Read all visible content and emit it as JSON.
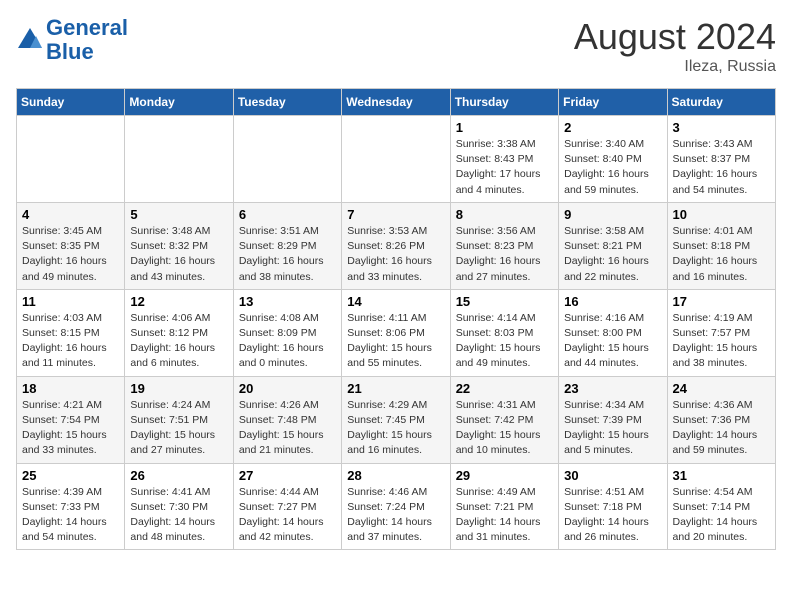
{
  "header": {
    "logo_line1": "General",
    "logo_line2": "Blue",
    "month_year": "August 2024",
    "location": "Ileza, Russia"
  },
  "days_of_week": [
    "Sunday",
    "Monday",
    "Tuesday",
    "Wednesday",
    "Thursday",
    "Friday",
    "Saturday"
  ],
  "weeks": [
    [
      {
        "day": "",
        "info": ""
      },
      {
        "day": "",
        "info": ""
      },
      {
        "day": "",
        "info": ""
      },
      {
        "day": "",
        "info": ""
      },
      {
        "day": "1",
        "info": "Sunrise: 3:38 AM\nSunset: 8:43 PM\nDaylight: 17 hours\nand 4 minutes."
      },
      {
        "day": "2",
        "info": "Sunrise: 3:40 AM\nSunset: 8:40 PM\nDaylight: 16 hours\nand 59 minutes."
      },
      {
        "day": "3",
        "info": "Sunrise: 3:43 AM\nSunset: 8:37 PM\nDaylight: 16 hours\nand 54 minutes."
      }
    ],
    [
      {
        "day": "4",
        "info": "Sunrise: 3:45 AM\nSunset: 8:35 PM\nDaylight: 16 hours\nand 49 minutes."
      },
      {
        "day": "5",
        "info": "Sunrise: 3:48 AM\nSunset: 8:32 PM\nDaylight: 16 hours\nand 43 minutes."
      },
      {
        "day": "6",
        "info": "Sunrise: 3:51 AM\nSunset: 8:29 PM\nDaylight: 16 hours\nand 38 minutes."
      },
      {
        "day": "7",
        "info": "Sunrise: 3:53 AM\nSunset: 8:26 PM\nDaylight: 16 hours\nand 33 minutes."
      },
      {
        "day": "8",
        "info": "Sunrise: 3:56 AM\nSunset: 8:23 PM\nDaylight: 16 hours\nand 27 minutes."
      },
      {
        "day": "9",
        "info": "Sunrise: 3:58 AM\nSunset: 8:21 PM\nDaylight: 16 hours\nand 22 minutes."
      },
      {
        "day": "10",
        "info": "Sunrise: 4:01 AM\nSunset: 8:18 PM\nDaylight: 16 hours\nand 16 minutes."
      }
    ],
    [
      {
        "day": "11",
        "info": "Sunrise: 4:03 AM\nSunset: 8:15 PM\nDaylight: 16 hours\nand 11 minutes."
      },
      {
        "day": "12",
        "info": "Sunrise: 4:06 AM\nSunset: 8:12 PM\nDaylight: 16 hours\nand 6 minutes."
      },
      {
        "day": "13",
        "info": "Sunrise: 4:08 AM\nSunset: 8:09 PM\nDaylight: 16 hours\nand 0 minutes."
      },
      {
        "day": "14",
        "info": "Sunrise: 4:11 AM\nSunset: 8:06 PM\nDaylight: 15 hours\nand 55 minutes."
      },
      {
        "day": "15",
        "info": "Sunrise: 4:14 AM\nSunset: 8:03 PM\nDaylight: 15 hours\nand 49 minutes."
      },
      {
        "day": "16",
        "info": "Sunrise: 4:16 AM\nSunset: 8:00 PM\nDaylight: 15 hours\nand 44 minutes."
      },
      {
        "day": "17",
        "info": "Sunrise: 4:19 AM\nSunset: 7:57 PM\nDaylight: 15 hours\nand 38 minutes."
      }
    ],
    [
      {
        "day": "18",
        "info": "Sunrise: 4:21 AM\nSunset: 7:54 PM\nDaylight: 15 hours\nand 33 minutes."
      },
      {
        "day": "19",
        "info": "Sunrise: 4:24 AM\nSunset: 7:51 PM\nDaylight: 15 hours\nand 27 minutes."
      },
      {
        "day": "20",
        "info": "Sunrise: 4:26 AM\nSunset: 7:48 PM\nDaylight: 15 hours\nand 21 minutes."
      },
      {
        "day": "21",
        "info": "Sunrise: 4:29 AM\nSunset: 7:45 PM\nDaylight: 15 hours\nand 16 minutes."
      },
      {
        "day": "22",
        "info": "Sunrise: 4:31 AM\nSunset: 7:42 PM\nDaylight: 15 hours\nand 10 minutes."
      },
      {
        "day": "23",
        "info": "Sunrise: 4:34 AM\nSunset: 7:39 PM\nDaylight: 15 hours\nand 5 minutes."
      },
      {
        "day": "24",
        "info": "Sunrise: 4:36 AM\nSunset: 7:36 PM\nDaylight: 14 hours\nand 59 minutes."
      }
    ],
    [
      {
        "day": "25",
        "info": "Sunrise: 4:39 AM\nSunset: 7:33 PM\nDaylight: 14 hours\nand 54 minutes."
      },
      {
        "day": "26",
        "info": "Sunrise: 4:41 AM\nSunset: 7:30 PM\nDaylight: 14 hours\nand 48 minutes."
      },
      {
        "day": "27",
        "info": "Sunrise: 4:44 AM\nSunset: 7:27 PM\nDaylight: 14 hours\nand 42 minutes."
      },
      {
        "day": "28",
        "info": "Sunrise: 4:46 AM\nSunset: 7:24 PM\nDaylight: 14 hours\nand 37 minutes."
      },
      {
        "day": "29",
        "info": "Sunrise: 4:49 AM\nSunset: 7:21 PM\nDaylight: 14 hours\nand 31 minutes."
      },
      {
        "day": "30",
        "info": "Sunrise: 4:51 AM\nSunset: 7:18 PM\nDaylight: 14 hours\nand 26 minutes."
      },
      {
        "day": "31",
        "info": "Sunrise: 4:54 AM\nSunset: 7:14 PM\nDaylight: 14 hours\nand 20 minutes."
      }
    ]
  ]
}
